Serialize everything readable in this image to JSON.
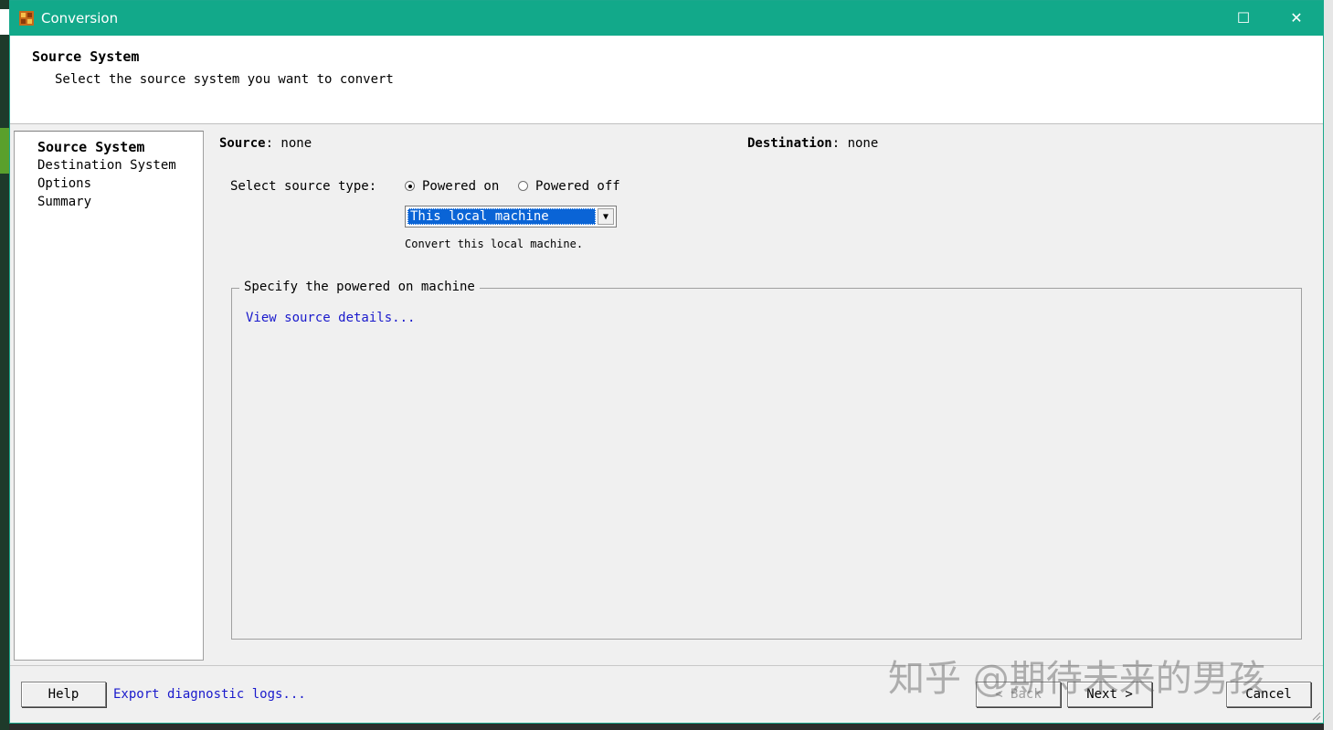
{
  "window": {
    "title": "Conversion",
    "controls": {
      "minimize": "—",
      "maximize": "☐",
      "close": "✕"
    }
  },
  "header": {
    "title": "Source System",
    "subtitle": "Select the source system you want to convert"
  },
  "nav": {
    "items": [
      {
        "label": "Source System",
        "active": true
      },
      {
        "label": "Destination System",
        "active": false
      },
      {
        "label": "Options",
        "active": false
      },
      {
        "label": "Summary",
        "active": false
      }
    ]
  },
  "main": {
    "source_label": "Source",
    "source_value": ": none",
    "destination_label": "Destination",
    "destination_value": ": none",
    "source_type_label": "Select source type:",
    "radio_powered_on": "Powered on",
    "radio_powered_off": "Powered off",
    "selected_type": "powered_on",
    "combo_value": "This local machine",
    "combo_hint": "Convert this local machine.",
    "group_legend": "Specify the powered on machine",
    "view_details_link": "View source details..."
  },
  "footer": {
    "help_label": "Help",
    "export_link": "Export diagnostic logs...",
    "back_label": "< Back",
    "next_label": "Next >",
    "cancel_label": "Cancel"
  },
  "watermark": "知乎 @期待未来的男孩",
  "colors": {
    "titlebar": "#12a98a",
    "selection": "#0a64d6",
    "link": "#1a1acc"
  }
}
